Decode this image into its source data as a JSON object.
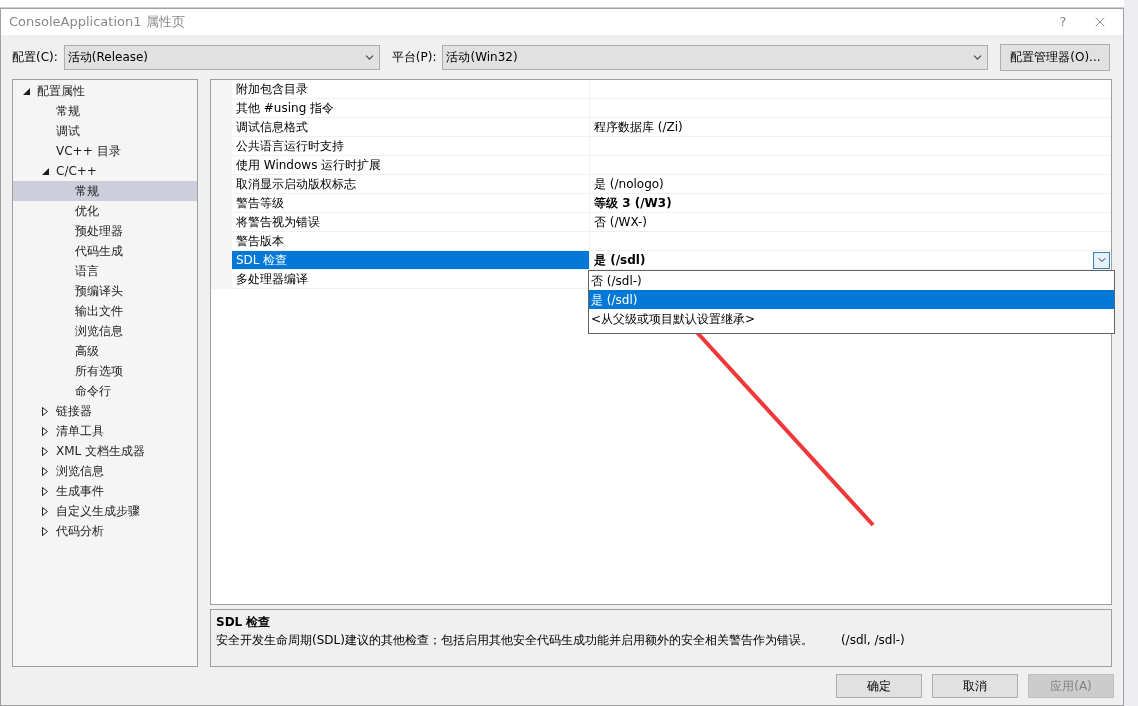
{
  "window": {
    "title": "ConsoleApplication1 属性页",
    "help": "?"
  },
  "config": {
    "label": "配置(C):",
    "value": "活动(Release)"
  },
  "platform": {
    "label": "平台(P):",
    "value": "活动(Win32)"
  },
  "config_manager_button": "配置管理器(O)...",
  "tree": [
    {
      "label": "配置属性",
      "expanded": true,
      "selected": false,
      "children": [
        {
          "label": "常规",
          "selected": false
        },
        {
          "label": "调试",
          "selected": false
        },
        {
          "label": "VC++ 目录",
          "selected": false
        },
        {
          "label": "C/C++",
          "expanded": true,
          "selected": false,
          "children": [
            {
              "label": "常规",
              "selected": true
            },
            {
              "label": "优化",
              "selected": false
            },
            {
              "label": "预处理器",
              "selected": false
            },
            {
              "label": "代码生成",
              "selected": false
            },
            {
              "label": "语言",
              "selected": false
            },
            {
              "label": "预编译头",
              "selected": false
            },
            {
              "label": "输出文件",
              "selected": false
            },
            {
              "label": "浏览信息",
              "selected": false
            },
            {
              "label": "高级",
              "selected": false
            },
            {
              "label": "所有选项",
              "selected": false
            },
            {
              "label": "命令行",
              "selected": false
            }
          ]
        },
        {
          "label": "链接器",
          "expanded": false,
          "selected": false
        },
        {
          "label": "清单工具",
          "expanded": false,
          "selected": false
        },
        {
          "label": "XML 文档生成器",
          "expanded": false,
          "selected": false
        },
        {
          "label": "浏览信息",
          "expanded": false,
          "selected": false
        },
        {
          "label": "生成事件",
          "expanded": false,
          "selected": false
        },
        {
          "label": "自定义生成步骤",
          "expanded": false,
          "selected": false
        },
        {
          "label": "代码分析",
          "expanded": false,
          "selected": false
        }
      ]
    }
  ],
  "properties": [
    {
      "name": "附加包含目录",
      "selected": false
    },
    {
      "name": "其他 #using 指令",
      "selected": false
    },
    {
      "name": "调试信息格式",
      "value": "程序数据库 (/Zi)",
      "bold": false,
      "selected": false
    },
    {
      "name": "公共语言运行时支持",
      "selected": false
    },
    {
      "name": "使用 Windows 运行时扩展",
      "selected": false
    },
    {
      "name": "取消显示启动版权标志",
      "value": "是 (/nologo)",
      "bold": false,
      "selected": false
    },
    {
      "name": "警告等级",
      "value": "等级 3 (/W3)",
      "bold": true,
      "selected": false
    },
    {
      "name": "将警告视为错误",
      "value": "否 (/WX-)",
      "bold": false,
      "selected": false
    },
    {
      "name": "警告版本",
      "selected": false
    },
    {
      "name": "SDL 检查",
      "value": "是 (/sdl)",
      "bold": true,
      "selected": true,
      "dropdown": [
        {
          "label": "否 (/sdl-)",
          "selected": false
        },
        {
          "label": "是 (/sdl)",
          "selected": true
        },
        {
          "label": "<从父级或项目默认设置继承>",
          "selected": false
        }
      ]
    },
    {
      "name": "多处理器编译",
      "selected": false
    }
  ],
  "description": {
    "title": "SDL 检查",
    "text": "安全开发生命周期(SDL)建议的其他检查；包括启用其他安全代码生成功能并启用额外的安全相关警告作为错误。",
    "switches": "(/sdl, /sdl-)"
  },
  "buttons": [
    {
      "label": "确定",
      "disabled": false
    },
    {
      "label": "取消",
      "disabled": false
    },
    {
      "label": "应用(A)",
      "disabled": true
    }
  ]
}
